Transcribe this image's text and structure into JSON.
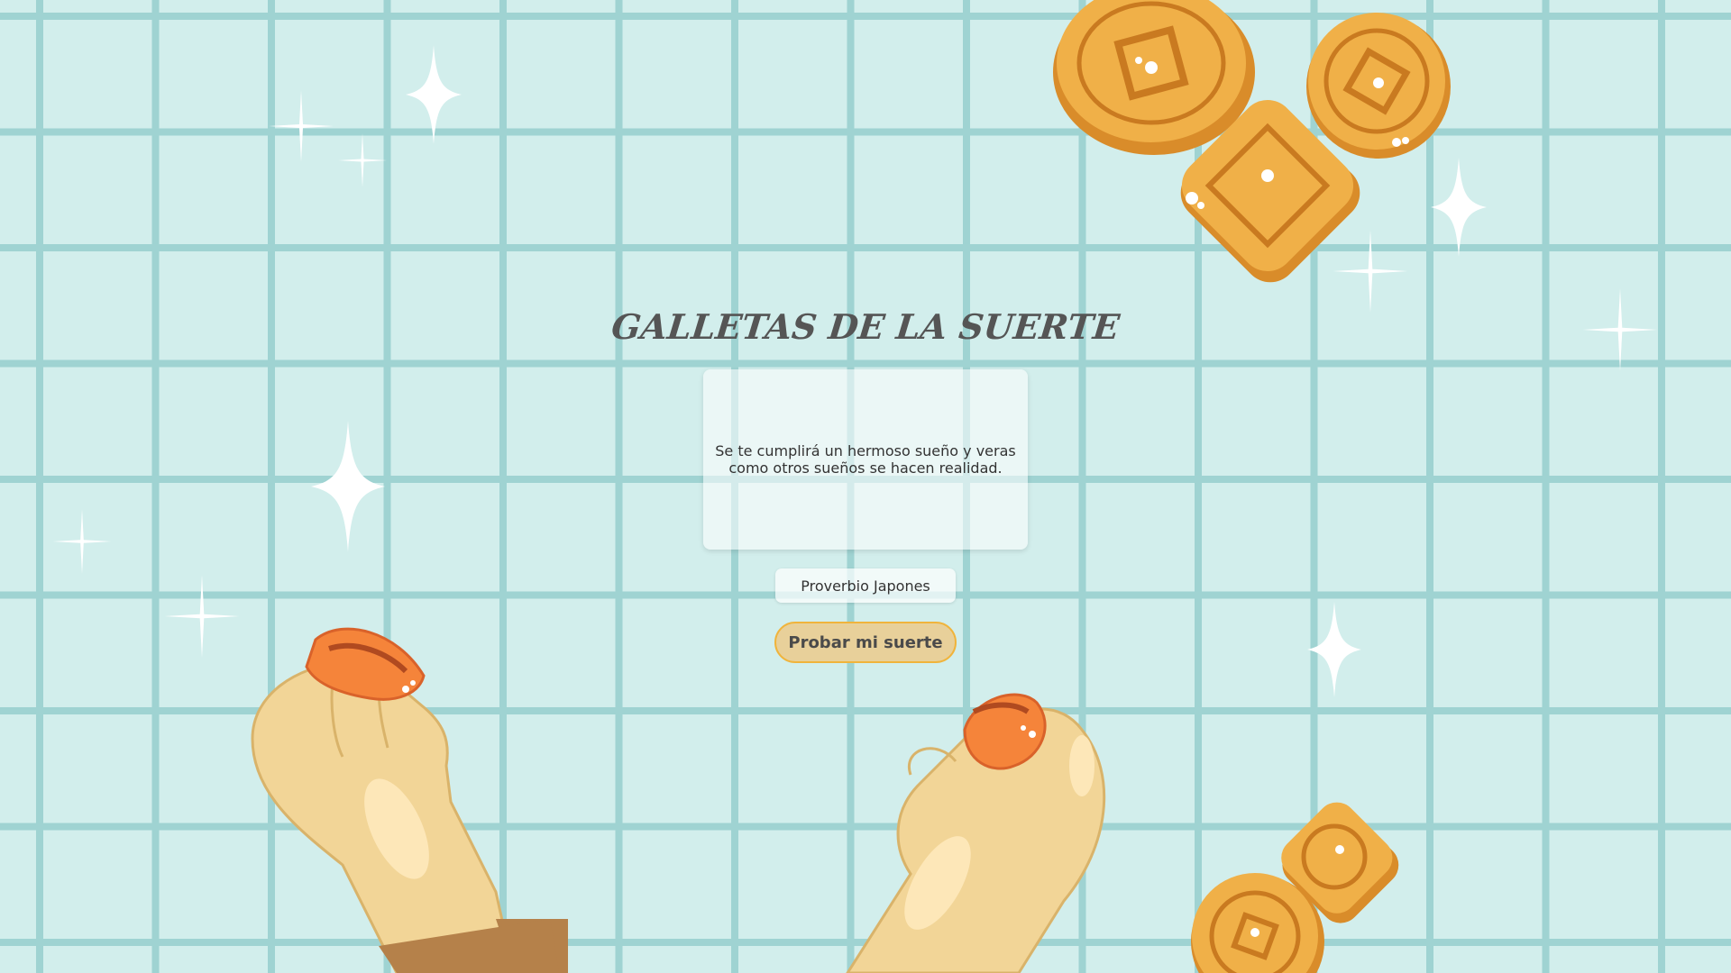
{
  "page": {
    "title": "GALLETAS DE LA SUERTE"
  },
  "fortune": {
    "text": "Se te cumplirá un hermoso sueño y veras como otros sueños se hacen realidad."
  },
  "author": {
    "label": "Proverbio Japones"
  },
  "actions": {
    "try_luck_label": "Probar mi suerte"
  },
  "colors": {
    "background": "#d2eeec",
    "grid_lines": "#9fd3d2",
    "button_fill": "#e8d09a",
    "button_border": "#f0b43c",
    "cookie": "#f0b048",
    "fortune_cookie_piece": "#f5843a",
    "hand": "#f2d597"
  },
  "icons": {
    "sparkle": "sparkle-icon",
    "mooncake": "mooncake-icon",
    "hand": "hand-holding-cookie-icon"
  }
}
